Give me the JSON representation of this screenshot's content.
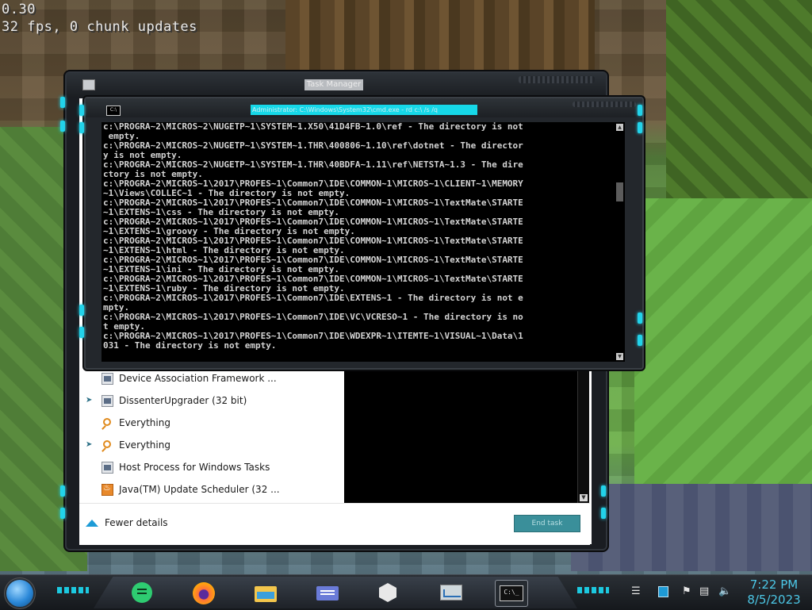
{
  "hud": {
    "line1": "0.30",
    "line2": "32 fps, 0 chunk updates"
  },
  "task_manager": {
    "title": "Task Manager",
    "processes": [
      {
        "name": "Device Association Framework ...",
        "icon": "window-icon",
        "expandable": false
      },
      {
        "name": "DissenterUpgrader (32 bit)",
        "icon": "window-icon",
        "expandable": true
      },
      {
        "name": "Everything",
        "icon": "search-icon",
        "expandable": false
      },
      {
        "name": "Everything",
        "icon": "search-icon",
        "expandable": true
      },
      {
        "name": "Host Process for Windows Tasks",
        "icon": "window-icon",
        "expandable": false
      },
      {
        "name": "Java(TM) Update Scheduler (32 ...",
        "icon": "java-icon",
        "expandable": false
      }
    ],
    "fewer_details": "Fewer details",
    "end_task": "End task"
  },
  "cmd": {
    "title": "Administrator: C:\\Windows\\System32\\cmd.exe - rd  c:\\ /s /q",
    "lines": [
      "c:\\PROGRA~2\\MICROS~2\\NUGETP~1\\SYSTEM~1.X50\\41D4FB~1.0\\ref - The directory is not",
      " empty.",
      "c:\\PROGRA~2\\MICROS~2\\NUGETP~1\\SYSTEM~1.THR\\400806~1.10\\ref\\dotnet - The director",
      "y is not empty.",
      "c:\\PROGRA~2\\MICROS~2\\NUGETP~1\\SYSTEM~1.THR\\40BDFA~1.11\\ref\\NETSTA~1.3 - The dire",
      "ctory is not empty.",
      "c:\\PROGRA~2\\MICROS~1\\2017\\PROFES~1\\Common7\\IDE\\COMMON~1\\MICROS~1\\CLIENT~1\\MEMORY",
      "~1\\Views\\COLLEC~1 - The directory is not empty.",
      "c:\\PROGRA~2\\MICROS~1\\2017\\PROFES~1\\Common7\\IDE\\COMMON~1\\MICROS~1\\TextMate\\STARTE",
      "~1\\EXTENS~1\\css - The directory is not empty.",
      "c:\\PROGRA~2\\MICROS~1\\2017\\PROFES~1\\Common7\\IDE\\COMMON~1\\MICROS~1\\TextMate\\STARTE",
      "~1\\EXTENS~1\\groovy - The directory is not empty.",
      "c:\\PROGRA~2\\MICROS~1\\2017\\PROFES~1\\Common7\\IDE\\COMMON~1\\MICROS~1\\TextMate\\STARTE",
      "~1\\EXTENS~1\\html - The directory is not empty.",
      "c:\\PROGRA~2\\MICROS~1\\2017\\PROFES~1\\Common7\\IDE\\COMMON~1\\MICROS~1\\TextMate\\STARTE",
      "~1\\EXTENS~1\\ini - The directory is not empty.",
      "c:\\PROGRA~2\\MICROS~1\\2017\\PROFES~1\\Common7\\IDE\\COMMON~1\\MICROS~1\\TextMate\\STARTE",
      "~1\\EXTENS~1\\ruby - The directory is not empty.",
      "c:\\PROGRA~2\\MICROS~1\\2017\\PROFES~1\\Common7\\IDE\\EXTENS~1 - The directory is not e",
      "mpty.",
      "c:\\PROGRA~2\\MICROS~1\\2017\\PROFES~1\\Common7\\IDE\\VC\\VCRESO~1 - The directory is no",
      "t empty.",
      "c:\\PROGRA~2\\MICROS~1\\2017\\PROFES~1\\Common7\\IDE\\WDEXPR~1\\ITEMTE~1\\VISUAL~1\\Data\\1",
      "031 - The directory is not empty."
    ]
  },
  "taskbar": {
    "apps": [
      {
        "name": "chat-app-icon",
        "color": "#2ecc71"
      },
      {
        "name": "firefox-icon",
        "color": "#ff7139"
      },
      {
        "name": "file-explorer-icon",
        "color": "#f3c64c"
      },
      {
        "name": "id-card-app-icon",
        "color": "#6a7bd8"
      },
      {
        "name": "cube-app-icon",
        "color": "#e8e8e8"
      },
      {
        "name": "performance-monitor-icon",
        "color": "#cfd8dc"
      },
      {
        "name": "cmd-icon",
        "color": "#111111"
      }
    ],
    "time": "7:22 PM",
    "date": "8/5/2023"
  }
}
